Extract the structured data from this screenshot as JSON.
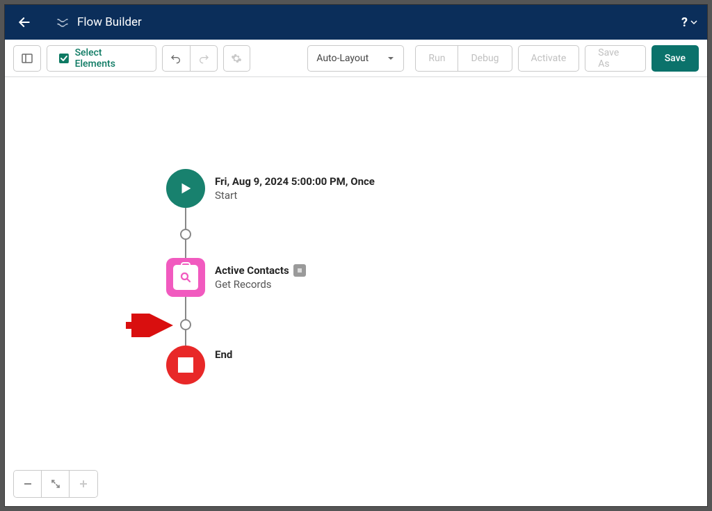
{
  "header": {
    "title": "Flow Builder"
  },
  "toolbar": {
    "select_elements": "Select Elements",
    "layout_mode": "Auto-Layout",
    "run": "Run",
    "debug": "Debug",
    "activate": "Activate",
    "save_as": "Save As",
    "save": "Save"
  },
  "nodes": {
    "start": {
      "title": "Fri, Aug 9, 2024 5:00:00 PM, Once",
      "subtitle": "Start"
    },
    "get_records": {
      "title": "Active Contacts",
      "subtitle": "Get Records"
    },
    "end": {
      "title": "End"
    }
  }
}
